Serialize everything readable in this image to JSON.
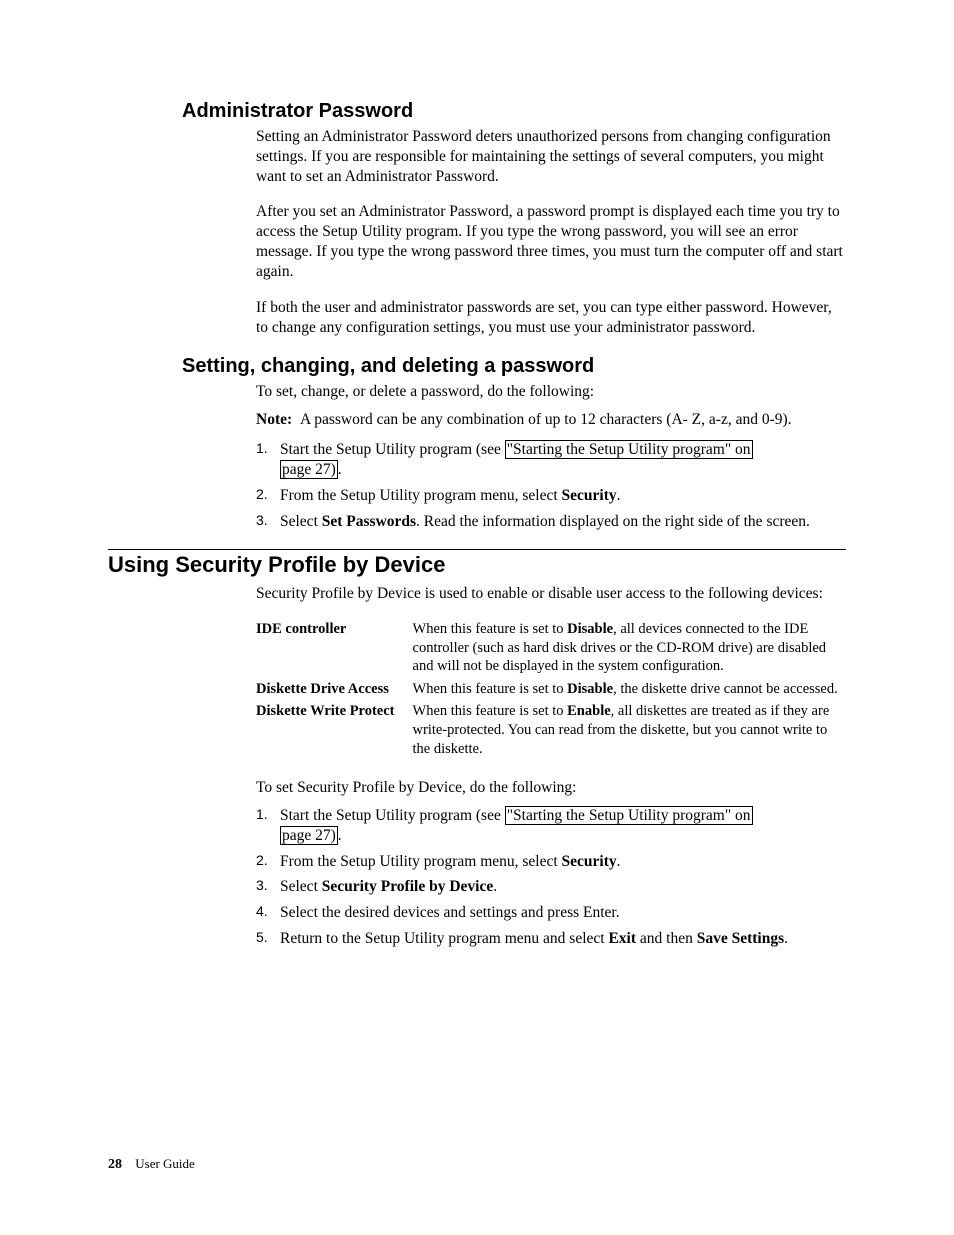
{
  "section1": {
    "title": "Administrator Password",
    "p1": "Setting an Administrator Password deters unauthorized persons from changing configuration settings. If you are responsible for maintaining the settings of several computers, you might want to set an Administrator Password.",
    "p2": "After you set an Administrator Password, a password prompt is displayed each time you try to access the Setup Utility program. If you type the wrong password, you will see an error message. If you type the wrong password three times, you must turn the computer off and start again.",
    "p3": "If both the user and administrator passwords are set, you can type either password. However, to change any configuration settings, you must use your administrator password."
  },
  "section2": {
    "title": "Setting, changing, and deleting a password",
    "intro": "To set, change, or delete a password, do the following:",
    "note_label": "Note:",
    "note_text": "A password can be any combination of up to 12 characters (A- Z, a-z, and 0-9).",
    "step1_a": "Start the Setup Utility program (see ",
    "step1_link1": "\"Starting the Setup Utility program\" on",
    "step1_link2": "page 27)",
    "step1_b": ".",
    "step2_a": "From the Setup Utility program menu, select ",
    "step2_b": "Security",
    "step2_c": ".",
    "step3_a": "Select ",
    "step3_b": "Set Passwords",
    "step3_c": ". Read the information displayed on the right side of the screen."
  },
  "section3": {
    "title": "Using Security Profile by Device",
    "intro": "Security Profile by Device is used to enable or disable user access to the following devices:",
    "defs": [
      {
        "term": "IDE controller",
        "pre": "When this feature is set to ",
        "bold": "Disable",
        "post": ", all devices connected to the IDE controller (such as hard disk drives or the CD-ROM drive) are disabled and will not be displayed in the system configuration."
      },
      {
        "term": "Diskette Drive Access",
        "pre": "When this feature is set to ",
        "bold": "Disable",
        "post": ", the diskette drive cannot be accessed."
      },
      {
        "term": "Diskette Write Protect",
        "pre": "When this feature is set to ",
        "bold": "Enable",
        "post": ", all diskettes are treated as if they are write-protected. You can read from the diskette, but you cannot write to the diskette."
      }
    ],
    "intro2": "To set Security Profile by Device, do the following:",
    "step1_a": "Start the Setup Utility program (see ",
    "step1_link1": "\"Starting the Setup Utility program\" on",
    "step1_link2": "page 27)",
    "step1_b": ".",
    "step2_a": "From the Setup Utility program menu, select ",
    "step2_b": "Security",
    "step2_c": ".",
    "step3_a": "Select ",
    "step3_b": "Security Profile by Device",
    "step3_c": ".",
    "step4": "Select the desired devices and settings and press Enter.",
    "step5_a": "Return to the Setup Utility program menu and select ",
    "step5_b": "Exit",
    "step5_c": " and then ",
    "step5_d": "Save Settings",
    "step5_e": "."
  },
  "footer": {
    "page": "28",
    "doc": "User Guide"
  }
}
